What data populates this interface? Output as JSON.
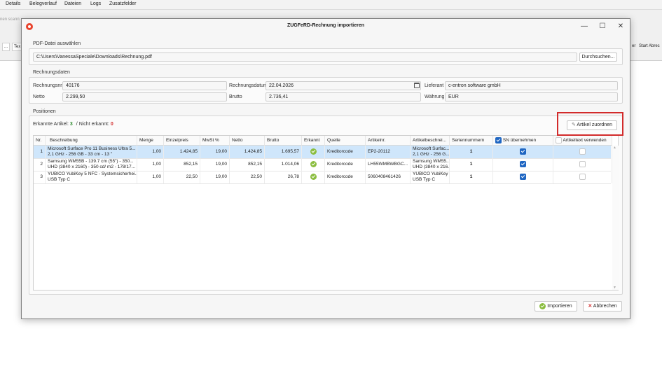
{
  "background": {
    "menu": [
      "Details",
      "Belegverlauf",
      "Dateien",
      "Logs",
      "Zusatzfelder"
    ],
    "search_fragment": "nen scann",
    "toolbar_left": [
      "...",
      "Tex"
    ],
    "toolbar_right": [
      "er",
      "Start Abrec"
    ]
  },
  "dialog": {
    "title": "ZUGFeRD-Rechnung importieren",
    "controls": {
      "minimize": "—",
      "maximize": "☐",
      "close": "✕"
    },
    "pdf_section": {
      "title": "PDF-Datei auswählen",
      "path": "C:\\Users\\VanessaSpeciale\\Downloads\\Rechnung.pdf",
      "browse_label": "Durchsuchen..."
    },
    "invoice_section": {
      "title": "Rechnungsdaten",
      "number_label": "Rechnungsnr.",
      "number_value": "40176",
      "date_label": "Rechnungsdatum",
      "date_value": "22.04.2026",
      "supplier_label": "Lieferant",
      "supplier_value": "c-entron software gmbH",
      "net_label": "Netto",
      "net_value": "2.299,50",
      "gross_label": "Brutto",
      "gross_value": "2.736,41",
      "currency_label": "Währung",
      "currency_value": "EUR"
    },
    "positions_section": {
      "title": "Positionen",
      "recognized_label": "Erkannte Artikel:",
      "recognized_count": "3",
      "separator": "/",
      "unrecognized_label": "Nicht erkannt:",
      "unrecognized_count": "0",
      "assign_button": "Artikel zuordnen",
      "status_colors": {
        "recognized": "#2e8b2e",
        "unrecognized": "#d22b2b"
      }
    },
    "grid": {
      "headers": [
        "Nr.",
        "Beschreibung",
        "Menge",
        "Einzelpreis",
        "MwSt %",
        "Netto",
        "Brutto",
        "Erkannt",
        "Quelle",
        "Artikelnr.",
        "Artikelbeschrei...",
        "Seriennummern",
        "SN übernehmen",
        "Artikeltext verwenden"
      ],
      "rows": [
        {
          "nr": "1",
          "desc1": "Microsoft Surface Pro 11 Business Ultra 5...",
          "desc2": "2,1 GHz - 256 GB - 33 cm - 13 \"",
          "menge": "1,00",
          "einzelpreis": "1.424,85",
          "mwst": "19,00",
          "netto": "1.424,85",
          "brutto": "1.695,57",
          "quelle": "Kreditorcode",
          "artikelnr": "EP2-20112",
          "abesch1": "Microsoft Surfac...",
          "abesch2": "2,1 GHz - 256 G...",
          "sn": "1",
          "sn_checked": true,
          "text_checked": false,
          "selected": true
        },
        {
          "nr": "2",
          "desc1": "Samsung WM55B - 139.7 cm (55\") - 350...",
          "desc2": "UHD (3840 x 2160) - 350 cd/ m2 - 178/17...",
          "menge": "1,00",
          "einzelpreis": "852,15",
          "mwst": "19,00",
          "netto": "852,15",
          "brutto": "1.014,06",
          "quelle": "Kreditorcode",
          "artikelnr": "LH55WMBWBGC...",
          "abesch1": "Samsung WM55...",
          "abesch2": "UHD (3840 x 216...",
          "sn": "1",
          "sn_checked": true,
          "text_checked": false,
          "selected": false
        },
        {
          "nr": "3",
          "desc1": "YUBICO YubiKey 5 NFC - Systemsicherhei...",
          "desc2": "USB Typ C",
          "menge": "1,00",
          "einzelpreis": "22,50",
          "mwst": "19,00",
          "netto": "22,50",
          "brutto": "26,78",
          "quelle": "Kreditorcode",
          "artikelnr": "5060408461426",
          "abesch1": "YUBICO YubiKey ...",
          "abesch2": "USB Typ C",
          "sn": "1",
          "sn_checked": true,
          "text_checked": false,
          "selected": false
        }
      ]
    },
    "footer": {
      "import_label": "Importieren",
      "cancel_label": "Abbrechen"
    }
  }
}
